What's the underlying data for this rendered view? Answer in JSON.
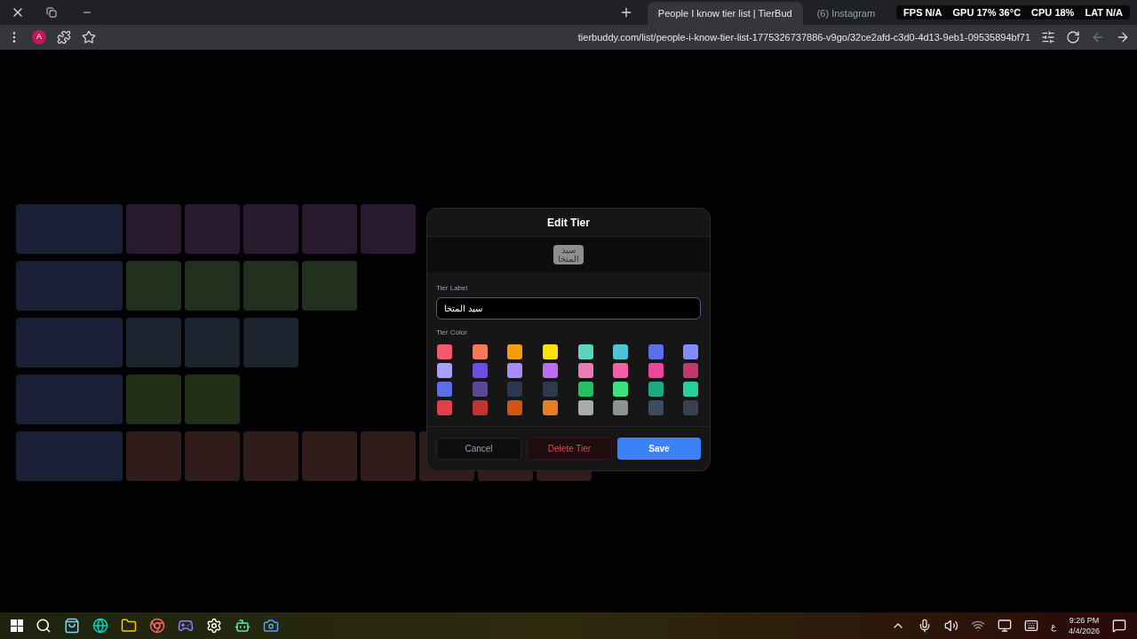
{
  "browser": {
    "tabs": [
      {
        "title": "People I know tier list | TierBud",
        "selected": true
      },
      {
        "title": "(6) Instagram",
        "selected": false
      }
    ],
    "url": "tierbuddy.com/list/people-i-know-tier-list-1775326737886-v9go/32ce2afd-c3d0-4d13-9eb1-09535894bf71",
    "profile": "A"
  },
  "overlay_stats": [
    {
      "label": "FPS",
      "value": "N/A"
    },
    {
      "label": "GPU",
      "value": "17% 36°C"
    },
    {
      "label": "CPU",
      "value": "18%"
    },
    {
      "label": "LAT",
      "value": "N/A"
    }
  ],
  "dialog": {
    "title": "Edit Tier",
    "preview": {
      "text": "سيد المتخا",
      "color": "#8f8f8f"
    },
    "label_field": {
      "label": "Tier Label",
      "value": "سيد المتخا"
    },
    "color_label": "Tier Color",
    "colors": [
      {
        "color": "#f05a6b"
      },
      {
        "color": "#f47b56"
      },
      {
        "color": "#f59e0b"
      },
      {
        "color": "#fde007"
      },
      {
        "color": "#5ed4c0"
      },
      {
        "color": "#4cc4d4"
      },
      {
        "color": "#5b70e8"
      },
      {
        "color": "#818cf8"
      },
      {
        "color": "#a5a0fa"
      },
      {
        "color": "#6d4ee0"
      },
      {
        "color": "#a78bfa"
      },
      {
        "color": "#c06cf0"
      },
      {
        "color": "#ec7bb5"
      },
      {
        "color": "#f062a6"
      },
      {
        "color": "#ec4899"
      },
      {
        "color": "#be3a6a"
      },
      {
        "color": "#5a6fe6"
      },
      {
        "color": "#5b4796"
      },
      {
        "color": "#2f3652"
      },
      {
        "color": "#2e3a4c"
      },
      {
        "color": "#22c05e"
      },
      {
        "color": "#3ee07a"
      },
      {
        "color": "#1fa882"
      },
      {
        "color": "#26d09a"
      },
      {
        "color": "#e0404a"
      },
      {
        "color": "#c33235"
      },
      {
        "color": "#d35410"
      },
      {
        "color": "#e67e22"
      },
      {
        "color": "#a5aca9"
      },
      {
        "color": "#8c9493"
      },
      {
        "color": "#3d4d60"
      },
      {
        "color": "#374150"
      }
    ],
    "buttons": {
      "cancel": "Cancel",
      "delete": "Delete Tier",
      "save": "Save"
    }
  },
  "taskbar": {
    "language": "ع",
    "time": "9:26 PM",
    "date": "4/4/2026"
  }
}
